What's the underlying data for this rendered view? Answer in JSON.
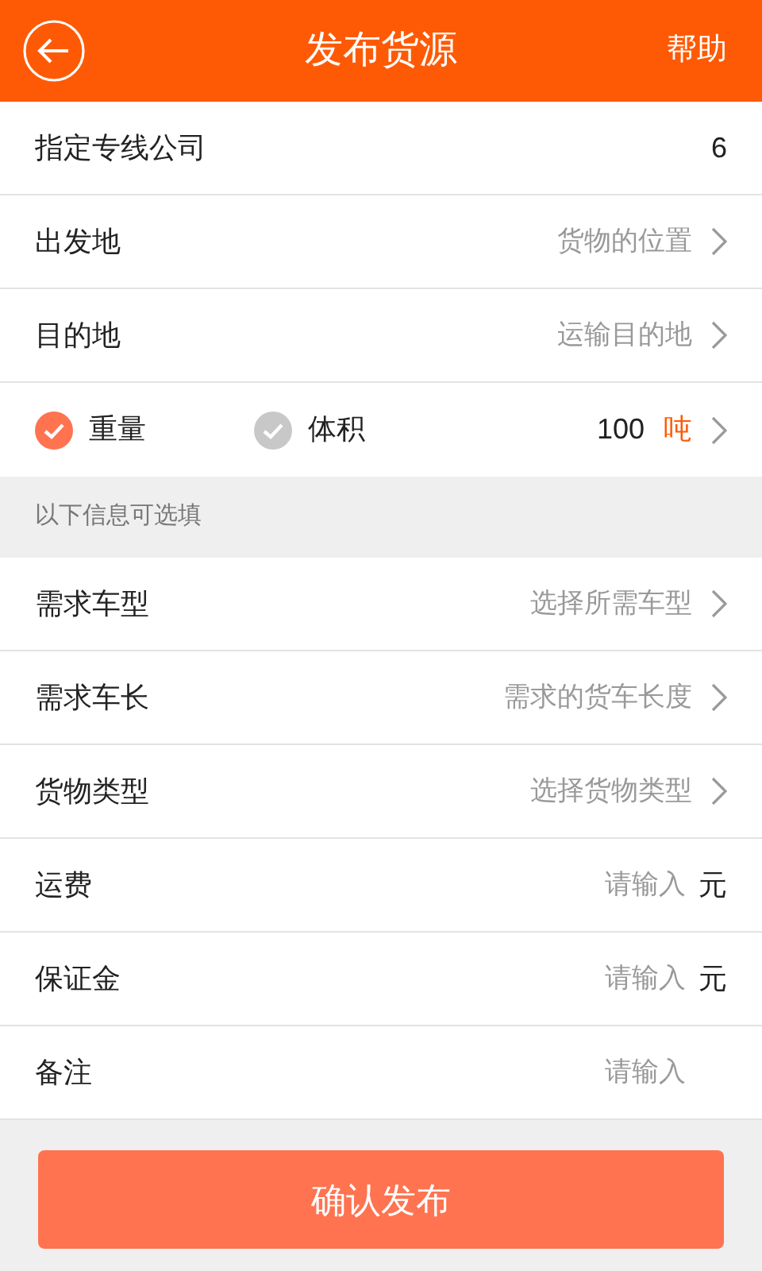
{
  "header": {
    "title": "发布货源",
    "help": "帮助"
  },
  "rows": [
    {
      "kind": "value",
      "label": "指定专线公司",
      "value": "6"
    },
    {
      "kind": "select",
      "label": "出发地",
      "placeholder": "货物的位置"
    },
    {
      "kind": "select",
      "label": "目的地",
      "placeholder": "运输目的地"
    }
  ],
  "measure": {
    "options": [
      {
        "label": "重量",
        "selected": true
      },
      {
        "label": "体积",
        "selected": false
      }
    ],
    "value": "100",
    "unit": "吨"
  },
  "section_label": "以下信息可选填",
  "optional_rows": [
    {
      "kind": "select",
      "label": "需求车型",
      "placeholder": "选择所需车型"
    },
    {
      "kind": "select",
      "label": "需求车长",
      "placeholder": "需求的货车长度"
    },
    {
      "kind": "select",
      "label": "货物类型",
      "placeholder": "选择货物类型"
    },
    {
      "kind": "input",
      "label": "运费",
      "placeholder": "请输入",
      "unit": "元"
    },
    {
      "kind": "input",
      "label": "保证金",
      "placeholder": "请输入",
      "unit": "元"
    },
    {
      "kind": "input",
      "label": "备注",
      "placeholder": "请输入"
    }
  ],
  "submit": "确认发布"
}
